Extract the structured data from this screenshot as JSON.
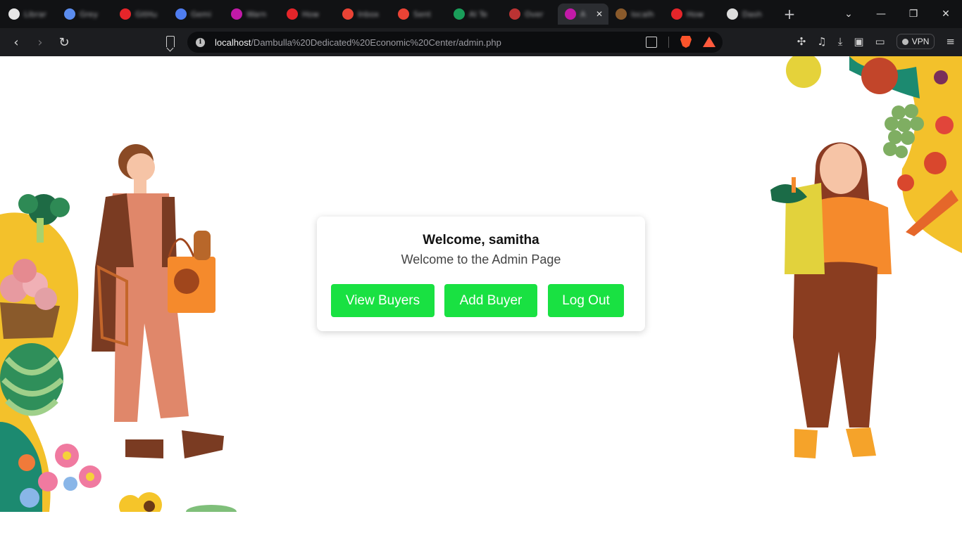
{
  "tabs": [
    {
      "label": "Librar",
      "color": "#e6e6e6"
    },
    {
      "label": "Grey",
      "color": "#5b8def"
    },
    {
      "label": "GitHu",
      "color": "#e5252a"
    },
    {
      "label": "Gemi",
      "color": "#4f7df0"
    },
    {
      "label": "Warn",
      "color": "#c21aa8"
    },
    {
      "label": "How",
      "color": "#e5252a"
    },
    {
      "label": "Inbox",
      "color": "#ea4335"
    },
    {
      "label": "Sent",
      "color": "#ea4335"
    },
    {
      "label": "AI Te",
      "color": "#1a9e5a"
    },
    {
      "label": "Over",
      "color": "#b33"
    },
    {
      "label": "A",
      "color": "#c21aa8",
      "active": true
    },
    {
      "label": "localh",
      "color": "#8a5a2b"
    },
    {
      "label": "How",
      "color": "#e5252a"
    },
    {
      "label": "Dash",
      "color": "#dddddd"
    }
  ],
  "address": {
    "host": "localhost",
    "path": "/Dambulla%20Dedicated%20Economic%20Center/admin.php"
  },
  "toolbar": {
    "vpn_label": "VPN"
  },
  "card": {
    "title": "Welcome, samitha",
    "subtitle": "Welcome to the Admin Page",
    "buttons": {
      "view_buyers": "View Buyers",
      "add_buyer": "Add Buyer",
      "log_out": "Log Out"
    }
  },
  "colors": {
    "accent": "#19e142",
    "tab_bg": "#111214",
    "toolbar_bg": "#1c1d20"
  }
}
